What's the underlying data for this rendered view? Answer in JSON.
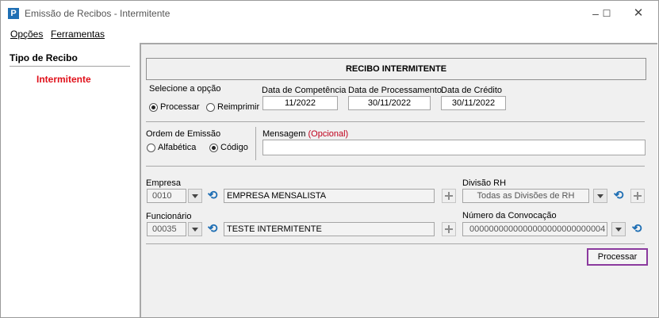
{
  "window": {
    "title": "Emissão de Recibos - Intermitente",
    "app_icon": "P"
  },
  "menu": {
    "opcoes": "Opções",
    "ferramentas": "Ferramentas"
  },
  "sidebar": {
    "title": "Tipo de Recibo",
    "items": [
      {
        "label": "Intermitente",
        "color": "#e0101a"
      }
    ]
  },
  "form": {
    "header": "RECIBO INTERMITENTE",
    "option_label": "Selecione a opção",
    "radio_processar": "Processar",
    "radio_reimprimir": "Reimprimir",
    "selected_option": "Processar",
    "data_competencia_label": "Data de Competência",
    "data_competencia": "11/2022",
    "data_processamento_label": "Data de Processamento",
    "data_processamento": "30/11/2022",
    "data_credito_label": "Data de Crédito",
    "data_credito": "30/11/2022",
    "ordem_label": "Ordem de Emissão",
    "radio_alfabetica": "Alfabética",
    "radio_codigo": "Código",
    "selected_ordem": "Código",
    "mensagem_label": "Mensagem",
    "mensagem_hint": "(Opcional)",
    "mensagem_value": "",
    "empresa_label": "Empresa",
    "empresa_code": "0010",
    "empresa_name": "EMPRESA MENSALISTA",
    "divisao_label": "Divisão RH",
    "divisao_value": "Todas as Divisões de RH",
    "funcionario_label": "Funcionário",
    "funcionario_code": "00035",
    "funcionario_name": "TESTE INTERMITENTE",
    "convocacao_label": "Número da Convocação",
    "convocacao_value": "0000000000000000000000000004",
    "processar_button": "Processar"
  },
  "colors": {
    "accent_button_border": "#8b3a9e",
    "undo_icon": "#1f6fb4",
    "optional_hint": "#c0001c"
  }
}
